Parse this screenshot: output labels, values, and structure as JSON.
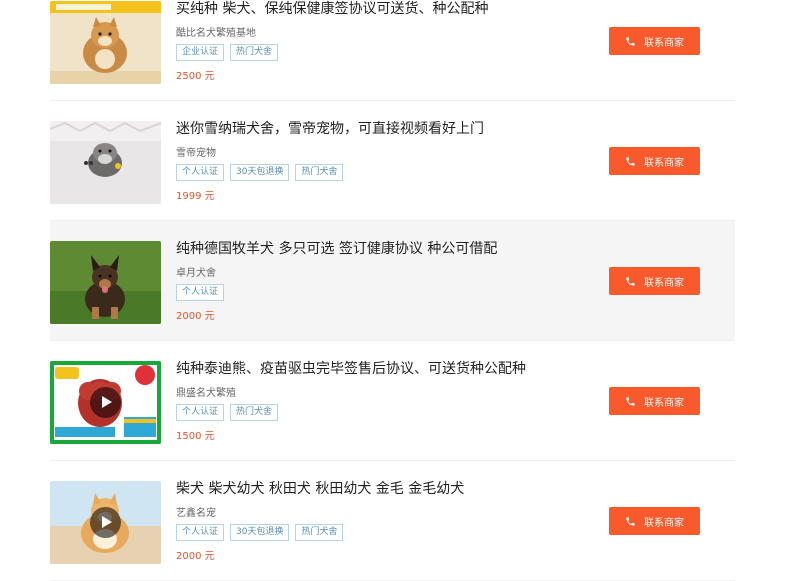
{
  "listings": [
    {
      "title": "买纯种 柴犬、保纯保健康签协议可送货、种公配种",
      "seller": "酷比名犬繁殖基地",
      "tags": [
        "企业认证",
        "热门犬舍"
      ],
      "price": "2500 元",
      "contact_label": "联系商家",
      "image": "shiba-puppy-photo",
      "has_video": false
    },
    {
      "title": "迷你雪纳瑞犬舍，雪帝宠物，可直接视频看好上门",
      "seller": "雪帝宠物",
      "tags": [
        "个人认证",
        "30天包退换",
        "热门犬舍"
      ],
      "price": "1999 元",
      "contact_label": "联系商家",
      "image": "schnauzer-puppy-photo",
      "has_video": false
    },
    {
      "title": "纯种德国牧羊犬 多只可选 签订健康协议 种公可借配",
      "seller": "卓月犬舍",
      "tags": [
        "个人认证"
      ],
      "price": "2000 元",
      "contact_label": "联系商家",
      "image": "german-shepherd-puppy-photo",
      "has_video": false
    },
    {
      "title": "纯种泰迪熊、疫苗驱虫完毕签售后协议、可送货种公配种",
      "seller": "鼎盛名犬繁殖",
      "tags": [
        "个人认证",
        "热门犬舍"
      ],
      "price": "1500 元",
      "contact_label": "联系商家",
      "image": "teddy-poodle-photo",
      "has_video": true
    },
    {
      "title": "柴犬 柴犬幼犬 秋田犬 秋田幼犬 金毛 金毛幼犬",
      "seller": "艺鑫名宠",
      "tags": [
        "个人认证",
        "30天包退换",
        "热门犬舍"
      ],
      "price": "2000 元",
      "contact_label": "联系商家",
      "image": "shiba-puppy-beach-photo",
      "has_video": true
    }
  ],
  "colors": {
    "accent": "#f95a2c",
    "price": "#e4532c",
    "tag_text": "#5a8fb5",
    "tag_border": "#b8d4e8",
    "highlight_bg": "#f5f5f5"
  },
  "icons": {
    "contact": "phone-icon",
    "video": "play-icon"
  }
}
